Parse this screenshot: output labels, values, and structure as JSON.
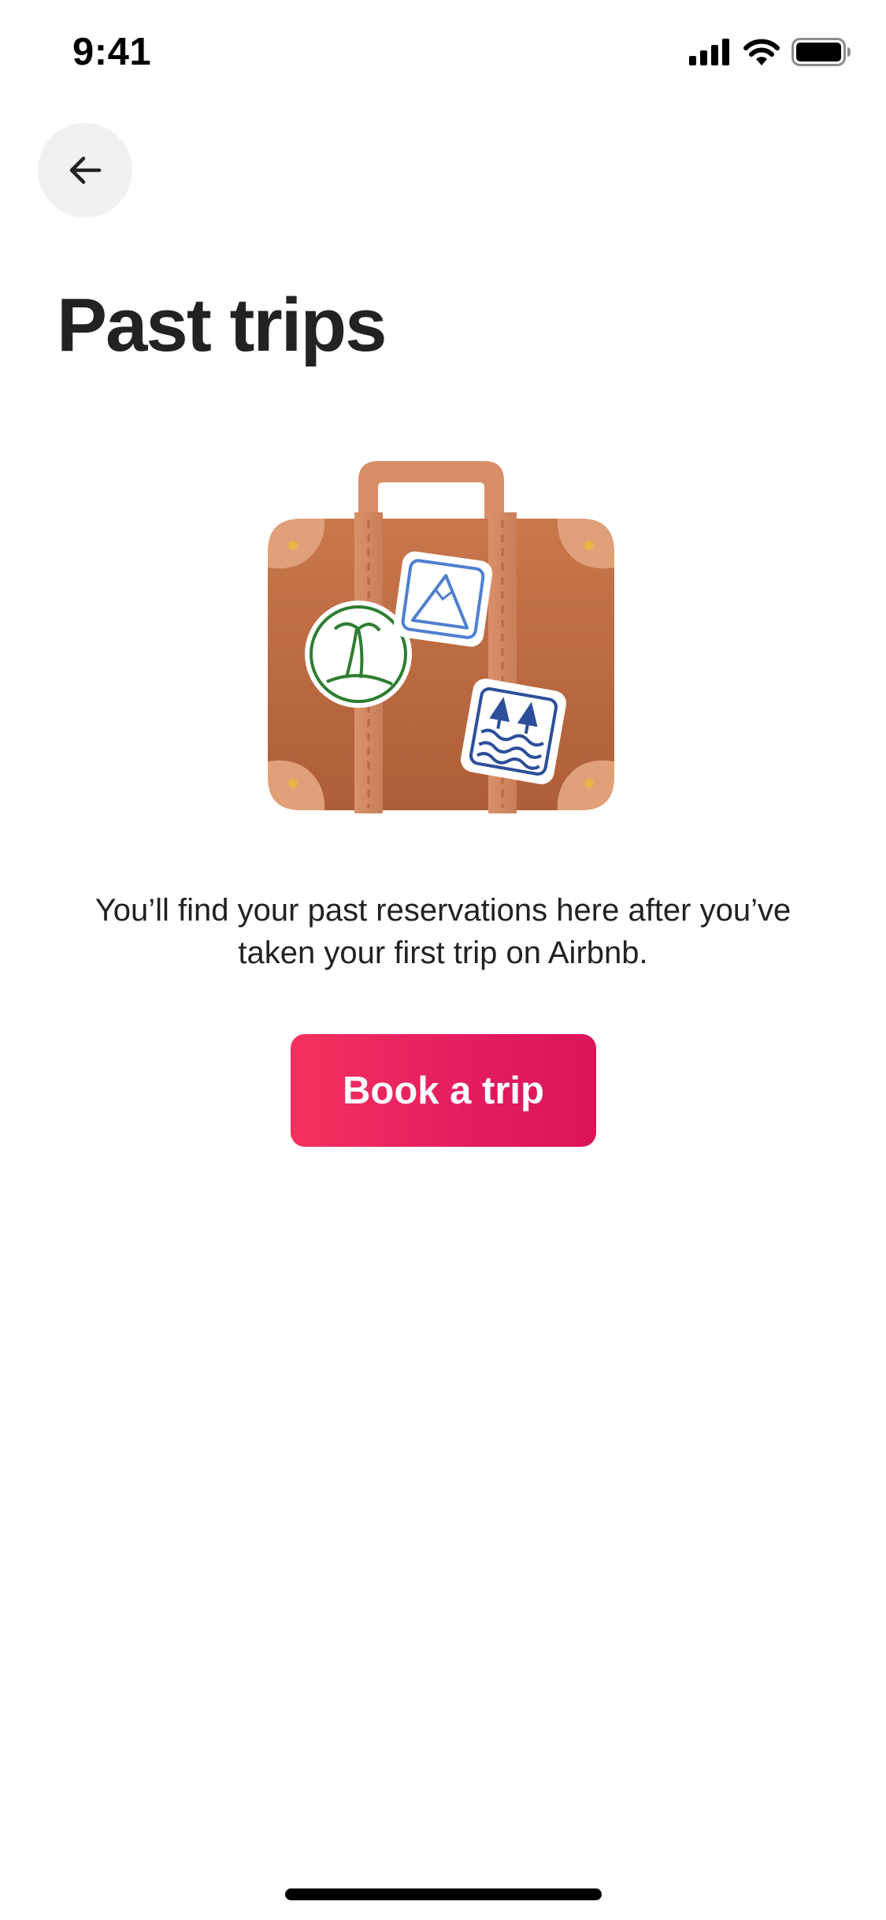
{
  "status_bar": {
    "time": "9:41",
    "icons": [
      "cellular-signal-icon",
      "wifi-icon",
      "battery-icon"
    ]
  },
  "header": {
    "back_icon": "arrow-left-icon"
  },
  "main": {
    "title": "Past trips",
    "illustration": "suitcase-with-travel-stickers",
    "message": "You’ll find your past reservations here after you’ve taken your first trip on Airbnb.",
    "cta_label": "Book a trip"
  },
  "colors": {
    "accent": "#E31C5F",
    "accent_gradient_start": "#F5315F",
    "text": "#222222",
    "back_button_bg": "#F1F1F1"
  }
}
